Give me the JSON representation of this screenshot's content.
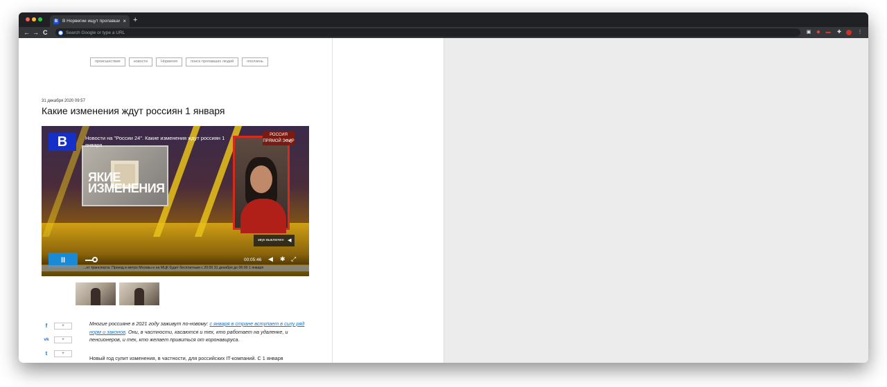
{
  "browser": {
    "tab_favicon": "В",
    "tab_title": "В Норвегии ищут пропавших",
    "tab_close": "×",
    "new_tab": "+",
    "nav_back": "←",
    "nav_forward": "→",
    "nav_reload": "C",
    "omnibox_placeholder": "Search Google or type a URL"
  },
  "article": {
    "tags": [
      "происшествия",
      "новости",
      "Норвегия",
      "поиск пропавших людей",
      "оползень"
    ],
    "date": "31 декабря 2020   09:57",
    "title": "Какие изменения ждут россиян 1 января"
  },
  "video": {
    "logo": "В",
    "overlay_title": "Новости на \"России 24\". Какие изменения ждут россиян 1 января",
    "studio_text": "ЯКИЕ\nИЗМЕНЕНИЯ",
    "channel_badge": "РОССИЯ\nПРЯМОЙ ЭФИР",
    "sound_off_label": "звук выключен",
    "play_label": "II",
    "time": "00:05:46",
    "ticker": "...нт транспорта: Проезд в метро Москвы и на МЦК будет бесплатным с 20:00 31 декабря до 06:00 1 января"
  },
  "social": {
    "facebook_icon": "f",
    "vk_icon": "vk",
    "twitter_icon": "t",
    "counter_label": "+"
  },
  "body": {
    "lead_before_link": "Многие россияне в 2021 году заживут по-новому: ",
    "lead_link": "с января в стране вступает в силу ряд норм и законов",
    "lead_after_link": ". Они, в частности, касаются и тех, кто работает на удаленке, и пенсионеров, и тех, кто желает привиться от коронавируса.",
    "paragraph_1": "Новый год сулит изменения, в частности, для российских IT-компаний. С 1 января"
  }
}
